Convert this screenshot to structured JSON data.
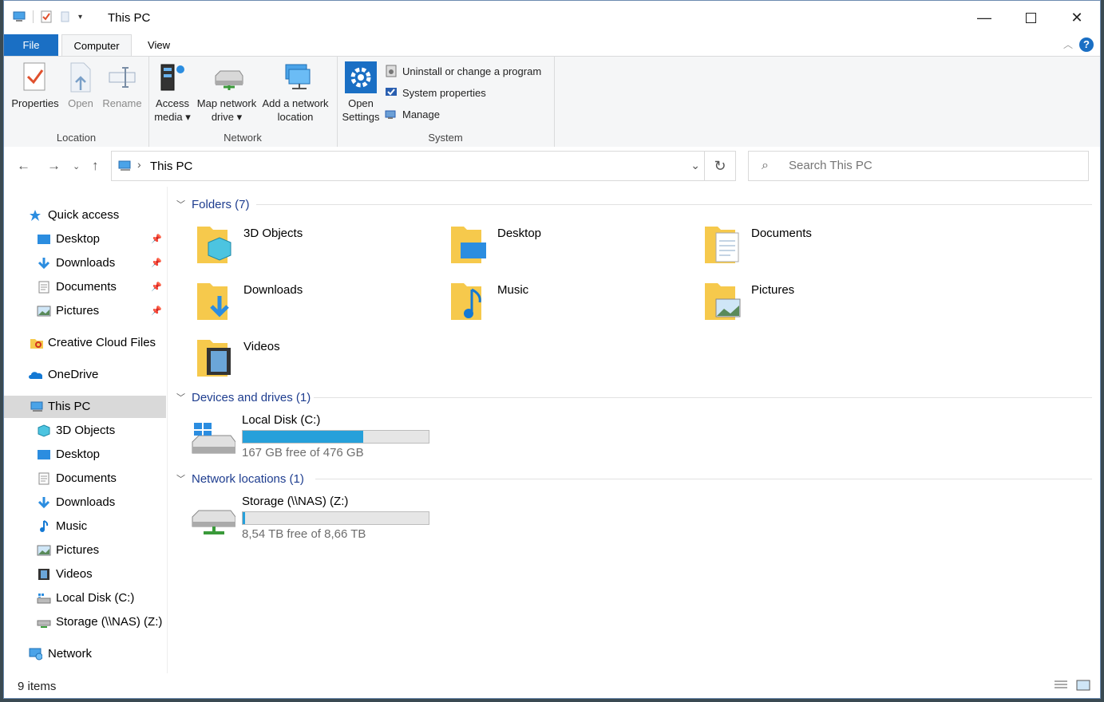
{
  "window": {
    "title": "This PC"
  },
  "ribbon": {
    "tabs": {
      "file": "File",
      "computer": "Computer",
      "view": "View"
    },
    "location": {
      "label": "Location",
      "properties": "Properties",
      "open": "Open",
      "rename": "Rename"
    },
    "network": {
      "label": "Network",
      "access_media": [
        "Access",
        "media ▾"
      ],
      "map_drive": [
        "Map network",
        "drive ▾"
      ],
      "add_location": [
        "Add a network",
        "location"
      ]
    },
    "system": {
      "label": "System",
      "open_settings": [
        "Open",
        "Settings"
      ],
      "uninstall": "Uninstall or change a program",
      "system_properties": "System properties",
      "manage": "Manage"
    }
  },
  "address": {
    "path": "This PC"
  },
  "search": {
    "placeholder": "Search This PC"
  },
  "sidebar": {
    "quick_access": "Quick access",
    "qa_items": [
      "Desktop",
      "Downloads",
      "Documents",
      "Pictures"
    ],
    "creative_cloud": "Creative Cloud Files",
    "onedrive": "OneDrive",
    "this_pc": "This PC",
    "pc_items": [
      "3D Objects",
      "Desktop",
      "Documents",
      "Downloads",
      "Music",
      "Pictures",
      "Videos",
      "Local Disk (C:)",
      "Storage (\\\\NAS) (Z:)"
    ],
    "network": "Network"
  },
  "content": {
    "folders_header": "Folders (7)",
    "folders": [
      "3D Objects",
      "Desktop",
      "Documents",
      "Downloads",
      "Music",
      "Pictures",
      "Videos"
    ],
    "devices_header": "Devices and drives (1)",
    "local_disk": {
      "name": "Local Disk (C:)",
      "free": "167 GB free of 476 GB",
      "used_fraction": 0.65
    },
    "network_header": "Network locations (1)",
    "nas": {
      "name": "Storage (\\\\NAS) (Z:)",
      "free": "8,54 TB free of 8,66 TB",
      "used_fraction": 0.014
    }
  },
  "status": {
    "count": "9 items"
  },
  "colors": {
    "accent": "#1a6fc4",
    "bar": "#26a0da",
    "folder": "#f6c94c"
  }
}
